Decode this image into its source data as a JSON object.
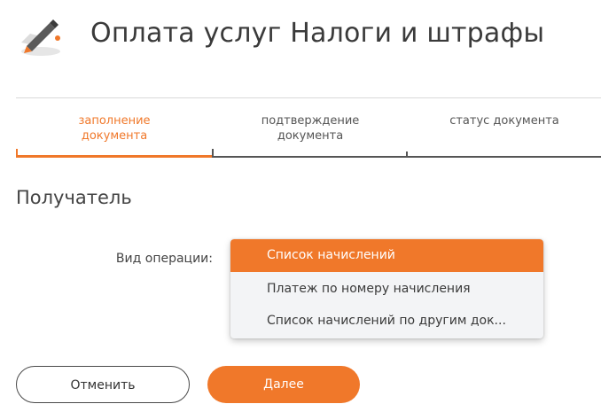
{
  "header": {
    "title": "Оплата услуг Налоги и штрафы",
    "icon": "pen-icon"
  },
  "steps": {
    "items": [
      {
        "label": "заполнение\nдокумента",
        "state": "active"
      },
      {
        "label": "подтверждение\nдокумента",
        "state": "pending"
      },
      {
        "label": "статус документа",
        "state": "pending"
      }
    ]
  },
  "form": {
    "section_title": "Получатель",
    "operation_label": "Вид операции:",
    "operation_options": [
      "Список начислений",
      "Платеж по номеру начисления",
      "Список начислений по другим док..."
    ],
    "selected_option": "Список начислений"
  },
  "buttons": {
    "cancel_label": "Отменить",
    "next_label": "Далее"
  },
  "colors": {
    "accent": "#f0782a",
    "text": "#333333",
    "dropdown_bg": "#f3f4f6"
  }
}
